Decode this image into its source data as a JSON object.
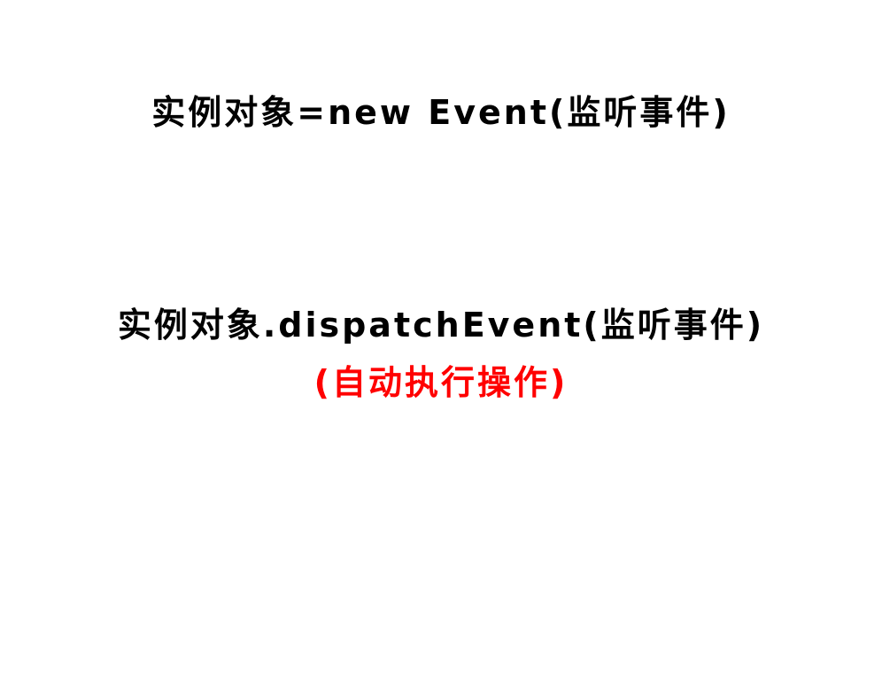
{
  "lines": {
    "constructor": "实例对象=new Event(监听事件)",
    "dispatch": "实例对象.dispatchEvent(监听事件)",
    "note": "(自动执行操作)"
  },
  "colors": {
    "text": "#000000",
    "note": "#ff0000",
    "background": "#ffffff"
  }
}
